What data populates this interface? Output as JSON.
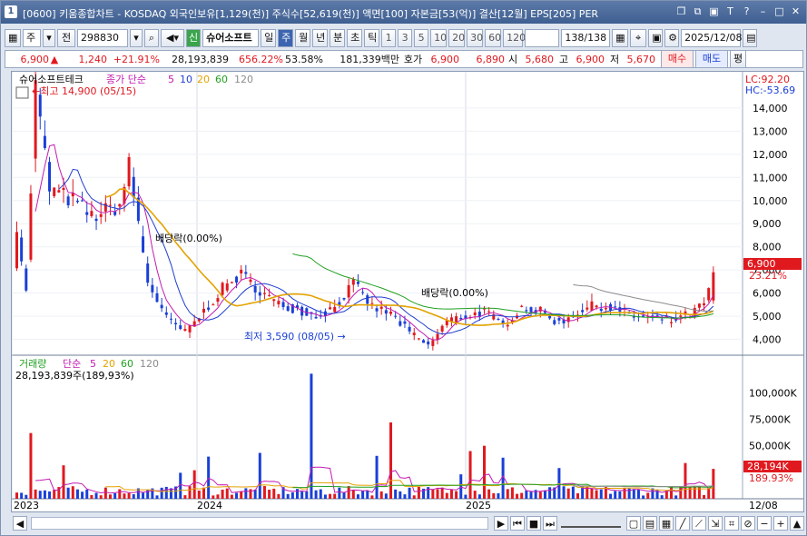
{
  "window": {
    "index": "1",
    "title": "[0600] 키움종합차트 - KOSDAQ 외국인보유[1,129(천)] 주식수[52,619(천)] 액면[100] 자본금[53(억)] 결산[12월] EPS[205] PER",
    "icons": [
      "restore-icon",
      "copy-icon",
      "lock-icon",
      "font-icon",
      "help-icon",
      "minimize-icon",
      "maximize-icon",
      "close-icon"
    ]
  },
  "toolbar": {
    "period_label": "주",
    "prev_label": "전",
    "code": "298830",
    "new_badge": "신",
    "stock_name": "슈어소프트",
    "periods": [
      "일",
      "주",
      "월",
      "년",
      "분",
      "초",
      "틱"
    ],
    "selected_period": "주",
    "intervals": [
      "1",
      "3",
      "5",
      "10",
      "20",
      "30",
      "60",
      "120"
    ],
    "page_count": "138/138",
    "date": "2025/12/08"
  },
  "quote": {
    "price": "6,900",
    "change": "1,240",
    "change_pct": "+21.91%",
    "volume": "28,193,839",
    "vol_ratio": "656.22%",
    "turnover": "53.58%",
    "amount": "181,339백만",
    "bid_label": "호가",
    "ask": "6,900",
    "bid": "6,890",
    "open_label": "시",
    "open": "5,680",
    "high_label": "고",
    "high": "6,900",
    "low_label": "저",
    "low": "5,670",
    "buy_label": "매수",
    "sell_label": "매도",
    "eval_label": "평"
  },
  "price_pane": {
    "legend_name": "슈어소프트테크",
    "legend_series": "종가 단순",
    "ma_labels": [
      "5",
      "10",
      "20",
      "60",
      "120"
    ],
    "ma_colors": [
      "#c21bb0",
      "#1f3fd0",
      "#e3a200",
      "#20a020",
      "#8c8c8c"
    ],
    "lc": "LC:92.20",
    "hc": "HC:-53.69",
    "high_marker": "최고 14,900 (05/15)",
    "low_marker": "최저 3,590 (08/05)",
    "dividend_1": "배당락(0.00%)",
    "dividend_2": "배당락(0.00%)",
    "last_price": "6,900",
    "last_pct": "23.21%",
    "y_ticks": [
      "14,000",
      "13,000",
      "12,000",
      "11,000",
      "10,000",
      "9,000",
      "8,000",
      "7,000",
      "6,000",
      "5,000",
      "4,000"
    ]
  },
  "volume_pane": {
    "legend_name": "거래량",
    "legend_series": "단순",
    "ma_labels": [
      "5",
      "20",
      "60",
      "120"
    ],
    "ma_colors": [
      "#c21bb0",
      "#e3a200",
      "#20a020",
      "#8c8c8c"
    ],
    "value_text": "28,193,839주(189,93%)",
    "last_vol": "28,194K",
    "last_pct": "189.93%",
    "y_ticks": [
      "100,000K",
      "75,000K",
      "50,000K"
    ]
  },
  "x_axis": {
    "labels": [
      "2023",
      "2024",
      "2025"
    ],
    "end_label": "12/08"
  },
  "chart_data": {
    "type": "candlestick",
    "frequency": "weekly",
    "price_range": [
      3500,
      15000
    ],
    "volume_range_k": [
      0,
      120000
    ],
    "series": [
      {
        "name": "종가 단순 5",
        "color": "#c21bb0"
      },
      {
        "name": "10",
        "color": "#1f3fd0"
      },
      {
        "name": "20",
        "color": "#e3a200"
      },
      {
        "name": "60",
        "color": "#20a020"
      },
      {
        "name": "120",
        "color": "#8c8c8c"
      }
    ],
    "price_anchors": [
      {
        "date": "2023-01",
        "price": 9000
      },
      {
        "date": "2023-05-15",
        "price": 14900
      },
      {
        "date": "2023-08",
        "price": 9000
      },
      {
        "date": "2023-11",
        "price": 4300
      },
      {
        "date": "2024-01",
        "price": 7000
      },
      {
        "date": "2024-04",
        "price": 5200
      },
      {
        "date": "2024-08-05",
        "price": 3590
      },
      {
        "date": "2024-11",
        "price": 5500
      },
      {
        "date": "2025-06",
        "price": 5100
      },
      {
        "date": "2025-12-08",
        "price": 6900
      }
    ],
    "last": {
      "price": 6900,
      "volume": 28193839
    }
  }
}
